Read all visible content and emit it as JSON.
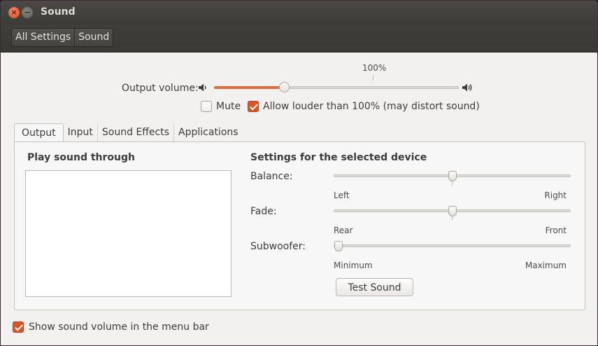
{
  "window": {
    "title": "Sound"
  },
  "breadcrumb": {
    "items": [
      "All Settings",
      "Sound"
    ]
  },
  "volume": {
    "label": "Output volume:",
    "percent_label": "100%",
    "value_fraction": 0.287,
    "accent_color": "#e46a3a"
  },
  "options": {
    "mute_label": "Mute",
    "mute_checked": false,
    "allow_louder_label": "Allow louder than 100% (may distort sound)",
    "allow_louder_checked": true
  },
  "tabs": [
    "Output",
    "Input",
    "Sound Effects",
    "Applications"
  ],
  "output": {
    "play_through_heading": "Play sound through",
    "settings_heading": "Settings for the selected device",
    "balance": {
      "label": "Balance:",
      "left": "Left",
      "right": "Right",
      "value_fraction": 0.5
    },
    "fade": {
      "label": "Fade:",
      "left": "Rear",
      "right": "Front",
      "value_fraction": 0.5
    },
    "subwoofer": {
      "label": "Subwoofer:",
      "left": "Minimum",
      "right": "Maximum",
      "value_fraction": 0.02
    },
    "test_button": "Test Sound"
  },
  "footer": {
    "menu_bar_label": "Show sound volume in the menu bar",
    "menu_bar_checked": true
  }
}
